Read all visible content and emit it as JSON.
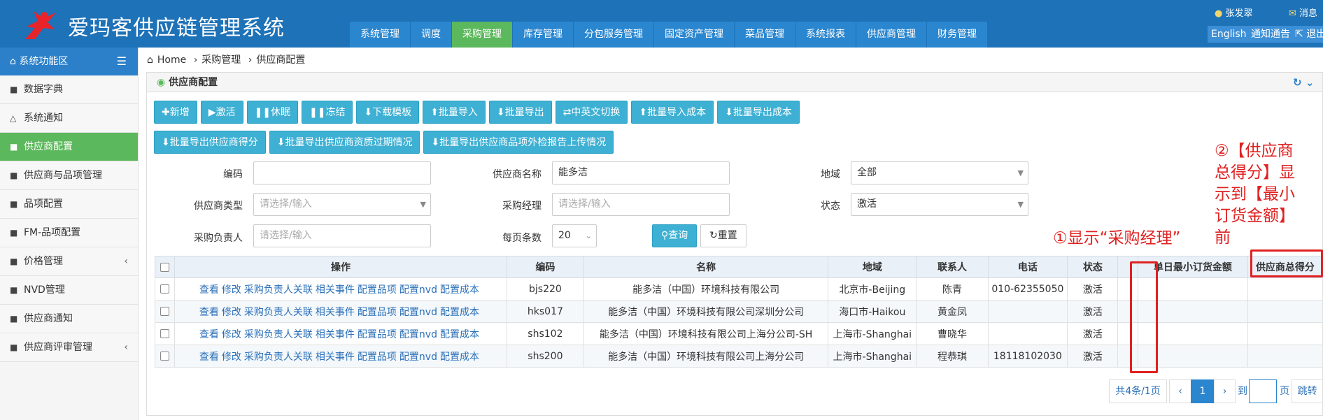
{
  "header": {
    "app_title": "爱玛客供应链管理系统",
    "nav": [
      "系统管理",
      "调度",
      "采购管理",
      "库存管理",
      "分包服务管理",
      "固定资产管理",
      "菜品管理",
      "系统报表",
      "供应商管理",
      "财务管理"
    ],
    "active_nav": "采购管理",
    "user": "张发翠",
    "message": "消息",
    "english": "English",
    "notice": "通知通告",
    "logout": "退出",
    "colors": {
      "bar": "#1e72b8",
      "active": "#5cb85c"
    }
  },
  "sidebar": {
    "title": "系统功能区",
    "items": [
      {
        "label": "数据字典",
        "icon": "folder-open-icon"
      },
      {
        "label": "系统通知",
        "icon": "bell-icon"
      },
      {
        "label": "供应商配置",
        "icon": "folder-open-icon",
        "active": true
      },
      {
        "label": "供应商与品项管理",
        "icon": "folder-open-icon"
      },
      {
        "label": "品项配置",
        "icon": "folder-open-icon"
      },
      {
        "label": "FM-品项配置",
        "icon": "folder-open-icon"
      },
      {
        "label": "价格管理",
        "icon": "folder-open-icon",
        "chevron": true
      },
      {
        "label": "NVD管理",
        "icon": "folder-open-icon"
      },
      {
        "label": "供应商通知",
        "icon": "folder-open-icon"
      },
      {
        "label": "供应商评审管理",
        "icon": "folder-open-icon",
        "chevron": true
      }
    ]
  },
  "breadcrumb": [
    "Home",
    "采购管理",
    "供应商配置"
  ],
  "panel": {
    "title": "供应商配置"
  },
  "toolbar_row1": [
    "✚新增",
    "▶激活",
    "❚❚休眠",
    "❚❚冻结",
    "⬇下载模板",
    "⬆批量导入",
    "⬇批量导出",
    "⇄中英文切换",
    "⬆批量导入成本",
    "⬇批量导出成本"
  ],
  "toolbar_row2": [
    "⬇批量导出供应商得分",
    "⬇批量导出供应商资质过期情况",
    "⬇批量导出供应商品项外检报告上传情况"
  ],
  "filters": {
    "code_label": "编码",
    "code_value": "",
    "name_label": "供应商名称",
    "name_value": "能多洁",
    "region_label": "地域",
    "region_value": "全部",
    "type_label": "供应商类型",
    "type_placeholder": "请选择/输入",
    "manager_label": "采购经理",
    "manager_placeholder": "请选择/输入",
    "status_label": "状态",
    "status_value": "激活",
    "owner_label": "采购负责人",
    "owner_placeholder": "请选择/输入",
    "pagesize_label": "每页条数",
    "pagesize_value": "20",
    "query_label": "查询",
    "reset_label": "重置"
  },
  "annotations": {
    "note1": "①显示“采购经理”",
    "note2_lines": [
      "②【供应商",
      "总得分】显",
      "示到【最小",
      "订货金额】",
      "前"
    ]
  },
  "table": {
    "columns": [
      "操作",
      "编码",
      "名称",
      "地域",
      "联系人",
      "电话",
      "状态",
      "",
      "单日最小订货金额",
      "供应商总得分"
    ],
    "ops_links": [
      "查看",
      "修改",
      "采购负责人关联",
      "相关事件",
      "配置品项",
      "配置nvd",
      "配置成本"
    ],
    "rows": [
      {
        "code": "bjs220",
        "name": "能多洁（中国）环境科技有限公司",
        "region": "北京市-Beijing",
        "contact": "陈青",
        "phone": "010-62355050",
        "status": "激活"
      },
      {
        "code": "hks017",
        "name": "能多洁（中国）环境科技有限公司深圳分公司",
        "region": "海口市-Haikou",
        "contact": "黄金凤",
        "phone": "",
        "status": "激活"
      },
      {
        "code": "shs102",
        "name": "能多洁（中国）环境科技有限公司上海分公司-SH",
        "region": "上海市-Shanghai",
        "contact": "曹晓华",
        "phone": "",
        "status": "激活"
      },
      {
        "code": "shs200",
        "name": "能多洁（中国）环境科技有限公司上海分公司",
        "region": "上海市-Shanghai",
        "contact": "程恭琪",
        "phone": "18118102030",
        "status": "激活"
      }
    ]
  },
  "pagination": {
    "summary": "共4条/1页",
    "prev": "‹",
    "current": "1",
    "next": "›",
    "goto_label": "到",
    "page_unit": "页",
    "jump": "跳转"
  }
}
